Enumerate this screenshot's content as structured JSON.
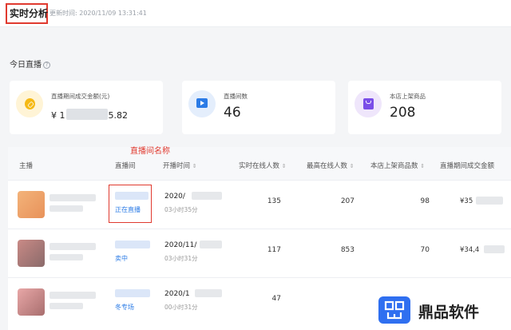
{
  "header": {
    "title": "实时分析",
    "update_time": "更新时间: 2020/11/09 13:31:41"
  },
  "section": {
    "label": "今日直播",
    "help_icon": "question-circle-icon"
  },
  "stats": [
    {
      "label": "直播期间成交金额(元)",
      "prefix": "¥",
      "value_start": "1",
      "value_end": "5.82",
      "icon": "coin-icon"
    },
    {
      "label": "直播间数",
      "value": "46",
      "icon": "tv-icon"
    },
    {
      "label": "本店上架商品",
      "value": "208",
      "icon": "shopping-bag-icon"
    }
  ],
  "annotation": "直播间名称",
  "table": {
    "columns": [
      "主播",
      "直播间",
      "开播时间",
      "实时在线人数",
      "最高在线人数",
      "本店上架商品数",
      "直播期间成交金额"
    ],
    "sort_arrow": "⇕",
    "rows": [
      {
        "status": "正在直播",
        "start": "2020/",
        "duration": "03小时35分",
        "online": "135",
        "peak": "207",
        "products": "98",
        "gmv": "¥35"
      },
      {
        "status": "卖中",
        "start": "2020/11/",
        "duration": "03小时31分",
        "online": "117",
        "peak": "853",
        "products": "70",
        "gmv": "¥34,4"
      },
      {
        "status": "冬专场",
        "start": "2020/1",
        "duration": "00小时31分",
        "online": "47",
        "peak": "",
        "products": "",
        "gmv": ""
      }
    ]
  },
  "watermark": {
    "text": "鼎品软件",
    "icon": "dingpin-logo-icon"
  },
  "colors": {
    "accent_blue": "#2b7be6",
    "annotation_red": "#e03a2f"
  }
}
